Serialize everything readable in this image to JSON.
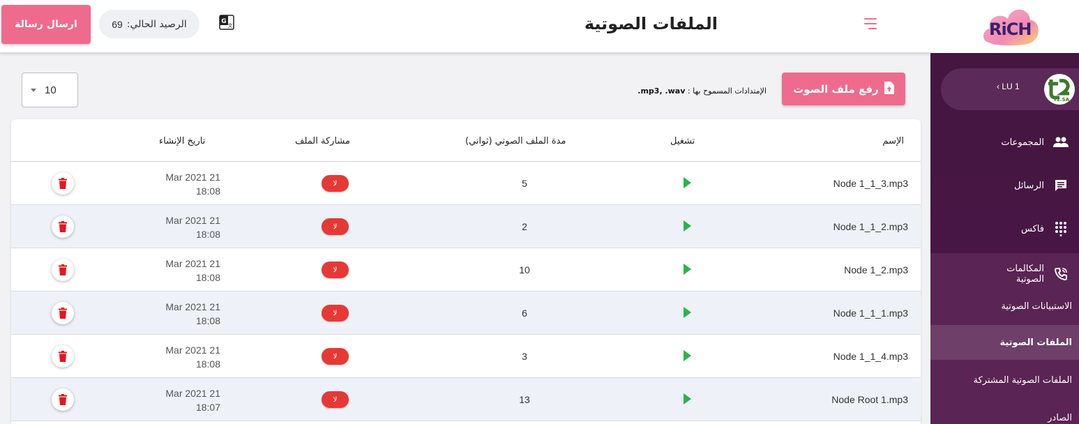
{
  "header": {
    "send_button": "ارسال رسالة",
    "balance_label": "الرصيد الحالي:",
    "balance_value": "69",
    "page_title": "الملفات الصوتية"
  },
  "logo": {
    "text": "RiCH"
  },
  "sidebar": {
    "user_label": "LU 1",
    "avatar_text": "T2.SA",
    "items": [
      {
        "label": "المجموعات",
        "icon": "group-icon"
      },
      {
        "label": "الرسائل",
        "icon": "message-icon"
      },
      {
        "label": "فاكس",
        "icon": "dialpad-icon"
      },
      {
        "label": "المكالمات الصوتية",
        "icon": "phone-call-icon"
      }
    ],
    "sub_items": [
      {
        "label": "الاستبيانات الصوتية"
      },
      {
        "label": "الملفات الصوتية",
        "active": true
      },
      {
        "label": "الملفات الصوتية المشتركة"
      },
      {
        "label": "الصادر"
      }
    ]
  },
  "toolbar": {
    "rows_per_page": "10",
    "allowed_ext_label": "الإمتدادات المسموح بها :",
    "allowed_ext_value": "mp3, .wav.",
    "upload_button": "رفع ملف الصوت"
  },
  "table": {
    "headers": {
      "name": "الإسم",
      "play": "تشغيل",
      "duration": "مدة الملف الصوتي (ثواني)",
      "share": "مشاركة الملف",
      "created": "تاريخ الإنشاء"
    },
    "rows": [
      {
        "name": "Node 1_1_3.mp3",
        "duration": "5",
        "share": "لا",
        "date": "Mar 2021 21",
        "time": "18:08"
      },
      {
        "name": "Node 1_1_2.mp3",
        "duration": "2",
        "share": "لا",
        "date": "Mar 2021 21",
        "time": "18:08"
      },
      {
        "name": "Node 1_2.mp3",
        "duration": "10",
        "share": "لا",
        "date": "Mar 2021 21",
        "time": "18:08"
      },
      {
        "name": "Node 1_1_1.mp3",
        "duration": "6",
        "share": "لا",
        "date": "Mar 2021 21",
        "time": "18:08"
      },
      {
        "name": "Node 1_1_4.mp3",
        "duration": "3",
        "share": "لا",
        "date": "Mar 2021 21",
        "time": "18:08"
      },
      {
        "name": "Node Root 1.mp3",
        "duration": "13",
        "share": "لا",
        "date": "Mar 2021 21",
        "time": "18:07"
      }
    ]
  },
  "colors": {
    "accent_pink": "#ef6b8e",
    "sidebar_purple": "#441640",
    "play_green": "#2cb34a",
    "share_red": "#e53935",
    "delete_red": "#e8141b"
  }
}
